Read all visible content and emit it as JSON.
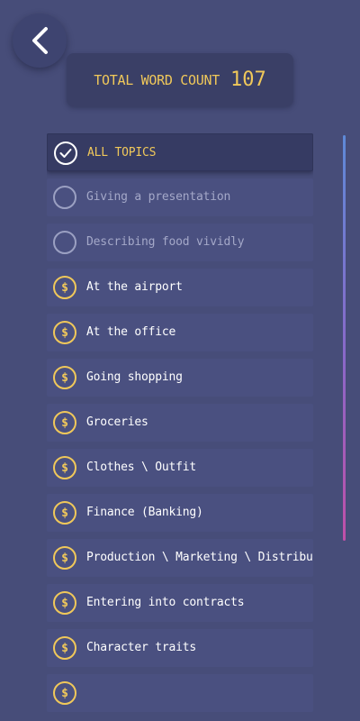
{
  "header": {
    "back_icon": "chevron-left-icon",
    "word_count_label": "TOTAL WORD COUNT",
    "word_count_value": "107"
  },
  "colors": {
    "background": "#474d79",
    "accent_gold": "#f0c85a",
    "item_background": "#4a5080",
    "active_item_background": "#363b63",
    "scrollbar_top": "#5e8ad8",
    "scrollbar_bottom": "#c050a8"
  },
  "topics": [
    {
      "label": "ALL TOPICS",
      "state": "selected",
      "icon": "check-circle-icon"
    },
    {
      "label": "Giving a presentation",
      "state": "available",
      "icon": "empty-circle-icon"
    },
    {
      "label": "Describing food vividly",
      "state": "available",
      "icon": "empty-circle-icon"
    },
    {
      "label": "At the airport",
      "state": "locked",
      "icon": "dollar-icon"
    },
    {
      "label": "At the office",
      "state": "locked",
      "icon": "dollar-icon"
    },
    {
      "label": "Going shopping",
      "state": "locked",
      "icon": "dollar-icon"
    },
    {
      "label": "Groceries",
      "state": "locked",
      "icon": "dollar-icon"
    },
    {
      "label": "Clothes \\ Outfit",
      "state": "locked",
      "icon": "dollar-icon"
    },
    {
      "label": "Finance (Banking)",
      "state": "locked",
      "icon": "dollar-icon"
    },
    {
      "label": "Production \\ Marketing \\ Distribution",
      "state": "locked",
      "icon": "dollar-icon"
    },
    {
      "label": "Entering into contracts",
      "state": "locked",
      "icon": "dollar-icon"
    },
    {
      "label": "Character traits",
      "state": "locked",
      "icon": "dollar-icon"
    }
  ]
}
